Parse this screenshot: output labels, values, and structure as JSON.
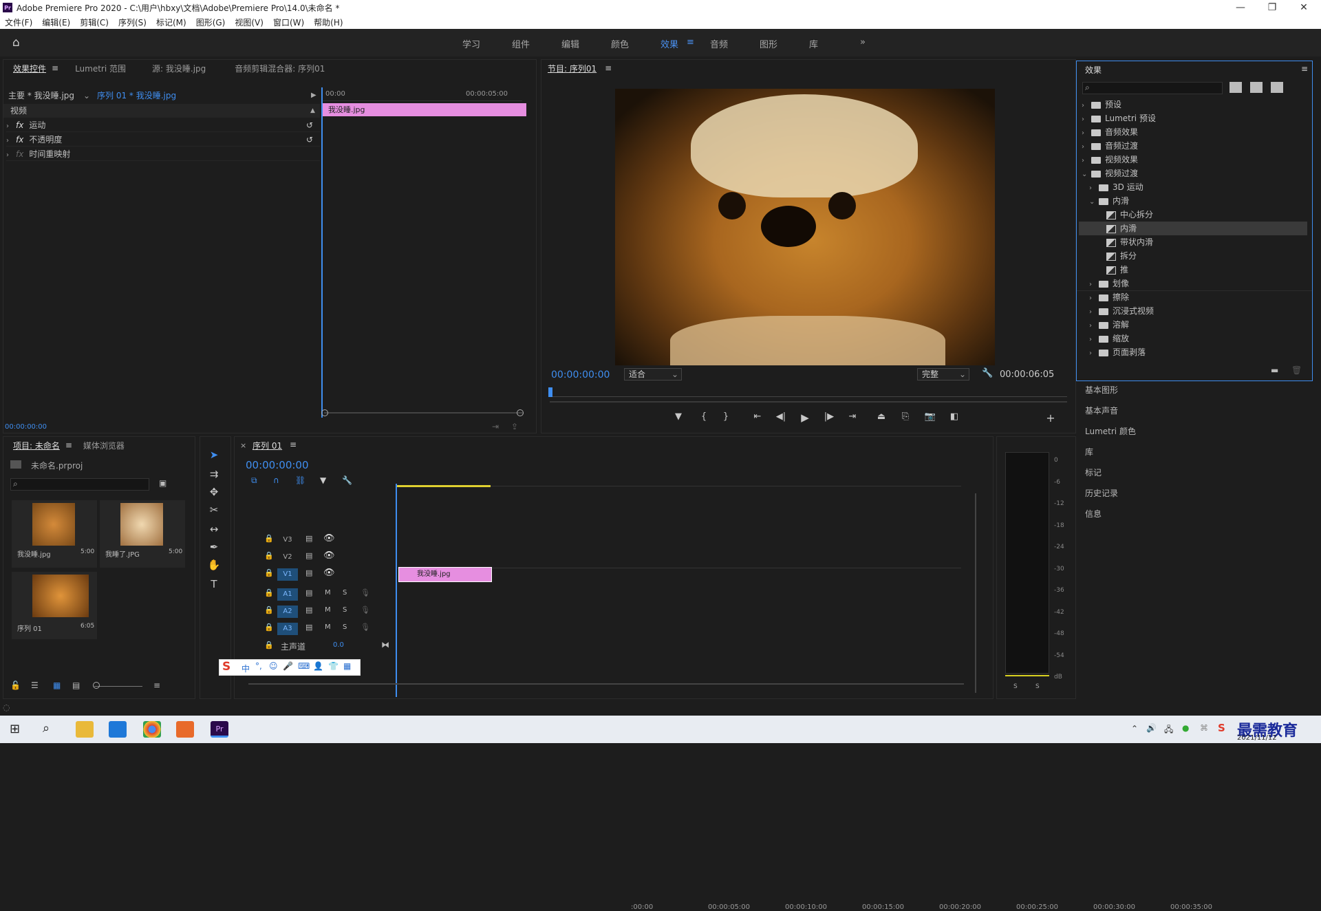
{
  "window": {
    "title": "Adobe Premiere Pro 2020 - C:\\用户\\hbxy\\文档\\Adobe\\Premiere Pro\\14.0\\未命名 *",
    "minimize": "—",
    "maximize": "❐",
    "close": "✕"
  },
  "menu": [
    "文件(F)",
    "编辑(E)",
    "剪辑(C)",
    "序列(S)",
    "标记(M)",
    "图形(G)",
    "视图(V)",
    "窗口(W)",
    "帮助(H)"
  ],
  "workspaces": [
    "学习",
    "组件",
    "编辑",
    "颜色",
    "效果",
    "音频",
    "图形",
    "库"
  ],
  "active_workspace": "效果",
  "effect_controls": {
    "tabs": [
      "效果控件",
      "Lumetri 范围",
      "源: 我没睡.jpg",
      "音频剪辑混合器: 序列01"
    ],
    "master": "主要 * 我没睡.jpg",
    "sequence": "序列 01 * 我没睡.jpg",
    "ruler_start": "00:00",
    "ruler_end": "00:00:05:00",
    "clip": "我没睡.jpg",
    "section": "视频",
    "rows": [
      "运动",
      "不透明度",
      "时间重映射"
    ],
    "timecode": "00:00:00:00"
  },
  "program": {
    "title": "节目: 序列01",
    "timecode": "00:00:00:00",
    "fit": "适合",
    "quality": "完整",
    "duration": "00:00:06:05"
  },
  "effects": {
    "title": "效果",
    "items": [
      {
        "label": "预设",
        "level": 0,
        "kind": "preset-folder",
        "open": false
      },
      {
        "label": "Lumetri 预设",
        "level": 0,
        "kind": "preset-folder",
        "open": false
      },
      {
        "label": "音频效果",
        "level": 0,
        "kind": "folder",
        "open": false
      },
      {
        "label": "音频过渡",
        "level": 0,
        "kind": "folder",
        "open": false
      },
      {
        "label": "视频效果",
        "level": 0,
        "kind": "folder",
        "open": false
      },
      {
        "label": "视频过渡",
        "level": 0,
        "kind": "folder",
        "open": true
      },
      {
        "label": "3D 运动",
        "level": 1,
        "kind": "folder",
        "open": false
      },
      {
        "label": "内滑",
        "level": 1,
        "kind": "folder",
        "open": true
      },
      {
        "label": "中心拆分",
        "level": 2,
        "kind": "effect"
      },
      {
        "label": "内滑",
        "level": 2,
        "kind": "effect",
        "selected": true
      },
      {
        "label": "带状内滑",
        "level": 2,
        "kind": "effect"
      },
      {
        "label": "拆分",
        "level": 2,
        "kind": "effect"
      },
      {
        "label": "推",
        "level": 2,
        "kind": "effect"
      },
      {
        "label": "划像",
        "level": 1,
        "kind": "folder",
        "open": false
      },
      {
        "label": "擦除",
        "level": 1,
        "kind": "folder",
        "open": false
      },
      {
        "label": "沉浸式视频",
        "level": 1,
        "kind": "folder",
        "open": false
      },
      {
        "label": "溶解",
        "level": 1,
        "kind": "folder",
        "open": false
      },
      {
        "label": "缩放",
        "level": 1,
        "kind": "folder",
        "open": false
      },
      {
        "label": "页面剥落",
        "level": 1,
        "kind": "folder",
        "open": false
      }
    ]
  },
  "side_panels": [
    "基本图形",
    "基本声音",
    "Lumetri 颜色",
    "库",
    "标记",
    "历史记录",
    "信息"
  ],
  "project": {
    "tabs": [
      "项目: 未命名",
      "媒体浏览器"
    ],
    "file": "未命名.prproj",
    "items": [
      {
        "name": "我没睡.jpg",
        "dur": "5:00"
      },
      {
        "name": "我睡了.JPG",
        "dur": "5:00"
      },
      {
        "name": "序列 01",
        "dur": "6:05"
      }
    ]
  },
  "timeline": {
    "title": "序列 01",
    "timecode": "00:00:00:00",
    "ruler": [
      ":00:00",
      "00:00:05:00",
      "00:00:10:00",
      "00:00:15:00",
      "00:00:20:00",
      "00:00:25:00",
      "00:00:30:00",
      "00:00:35:00"
    ],
    "video_tracks": [
      "V3",
      "V2",
      "V1"
    ],
    "audio_tracks": [
      "A1",
      "A2",
      "A3"
    ],
    "master": "主声道",
    "master_value": "0.0",
    "clip": "我没睡.jpg",
    "m": "M",
    "s": "S"
  },
  "meter": {
    "ticks": [
      "0",
      "-6",
      "-12",
      "-18",
      "-24",
      "-30",
      "-36",
      "-42",
      "-48",
      "-54",
      "dB"
    ],
    "s": "S"
  },
  "ime": {
    "label": "中"
  },
  "taskbar": {
    "date": "2021/11/12",
    "brand": "最需教育"
  },
  "colors": {
    "accent": "#3f8ef0",
    "clip": "#e68ee0",
    "selected": "#3a3a3a"
  }
}
